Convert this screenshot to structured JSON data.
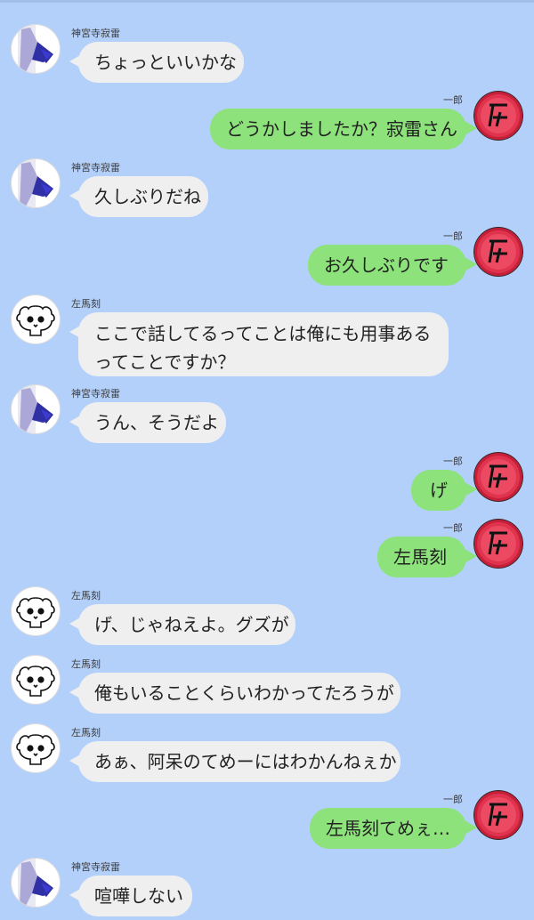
{
  "theme": {
    "background": "#B3D0FB",
    "incoming_bubble": "#EFEFEF",
    "outgoing_bubble": "#8DE27B",
    "avatar_ichiro_color": "#E0334D"
  },
  "messages": [
    {
      "sender": "神宮寺寂雷",
      "text": "ちょっといいかな",
      "side": "left",
      "avatar_icon": "jakurai-avatar-icon"
    },
    {
      "sender": "一郎",
      "text": "どうかしましたか？寂雷さん",
      "side": "right",
      "avatar_icon": "ichiro-emblem-icon"
    },
    {
      "sender": "神宮寺寂雷",
      "text": "久しぶりだね",
      "side": "left",
      "avatar_icon": "jakurai-avatar-icon"
    },
    {
      "sender": "一郎",
      "text": "お久しぶりです",
      "side": "right",
      "avatar_icon": "ichiro-emblem-icon"
    },
    {
      "sender": "左馬刻",
      "text": "ここで話してるってことは俺にも用事あるってことですか？",
      "side": "left",
      "avatar_icon": "skull-icon"
    },
    {
      "sender": "神宮寺寂雷",
      "text": "うん、そうだよ",
      "side": "left",
      "avatar_icon": "jakurai-avatar-icon"
    },
    {
      "sender": "一郎",
      "text": "げ",
      "side": "right",
      "avatar_icon": "ichiro-emblem-icon"
    },
    {
      "sender": "一郎",
      "text": "左馬刻",
      "side": "right",
      "avatar_icon": "ichiro-emblem-icon"
    },
    {
      "sender": "左馬刻",
      "text": "げ、じゃねえよ。グズが",
      "side": "left",
      "avatar_icon": "skull-icon"
    },
    {
      "sender": "左馬刻",
      "text": "俺もいることくらいわかってたろうが",
      "side": "left",
      "avatar_icon": "skull-icon"
    },
    {
      "sender": "左馬刻",
      "text": "あぁ、阿呆のてめーにはわかんねぇか",
      "side": "left",
      "avatar_icon": "skull-icon"
    },
    {
      "sender": "一郎",
      "text": "左馬刻てめぇ…",
      "side": "right",
      "avatar_icon": "ichiro-emblem-icon"
    },
    {
      "sender": "神宮寺寂雷",
      "text": "喧嘩しない",
      "side": "left",
      "avatar_icon": "jakurai-avatar-icon"
    }
  ]
}
